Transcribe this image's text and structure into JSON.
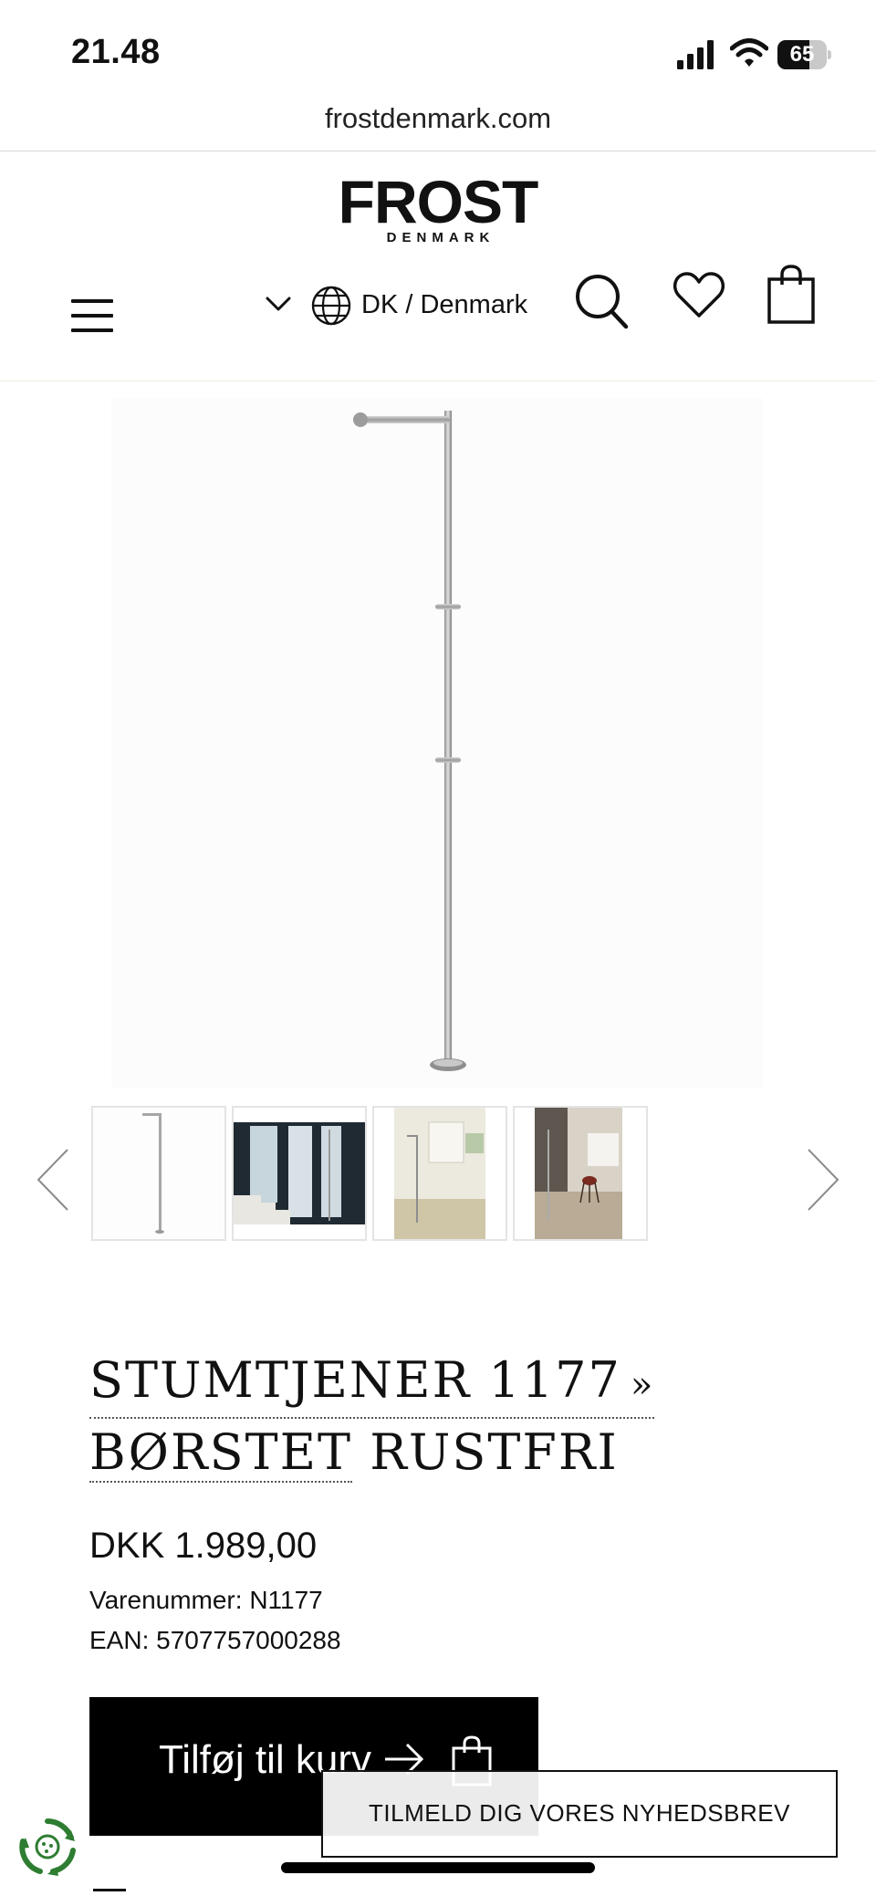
{
  "status_bar": {
    "time": "21.48",
    "battery_level": "65",
    "battery_fraction": 0.65
  },
  "browser": {
    "url": "frostdenmark.com"
  },
  "header": {
    "logo_main": "FROST",
    "logo_sub": "DENMARK",
    "country": "DK / Denmark",
    "icons": [
      "menu-icon",
      "chevron-down-icon",
      "globe-icon",
      "search-icon",
      "heart-icon",
      "shopping-bag-icon"
    ]
  },
  "gallery": {
    "thumbnails": [
      {
        "label": "Product on white background"
      },
      {
        "label": "Stairwell scene"
      },
      {
        "label": "Bathroom scene"
      },
      {
        "label": "Room with chair"
      }
    ],
    "icons": [
      "chevron-left-icon",
      "chevron-right-icon"
    ]
  },
  "product": {
    "title_line1": "STUMTJENER 1177",
    "title_arrow": "»",
    "title_line2": "BØRSTET",
    "title_line2_rest": "RUSTFRI",
    "price": "DKK 1.989,00",
    "sku": "Varenummer: N1177",
    "ean": "EAN: 5707757000288",
    "add_to_cart_label": "Tilføj til kurv"
  },
  "newsletter": {
    "label": "TILMELD DIG VORES NYHEDSBREV"
  },
  "colors": {
    "accent": "#000000",
    "background": "#ffffff",
    "cookie_green": "#2e7d32"
  }
}
